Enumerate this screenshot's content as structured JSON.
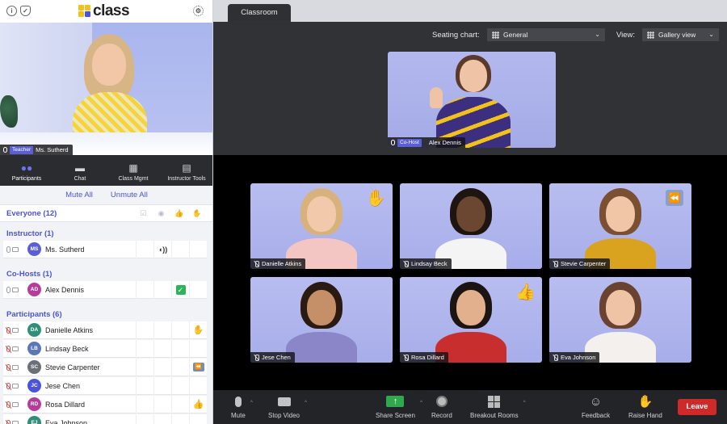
{
  "app": {
    "logo_text": "class",
    "info_icon": "info-icon",
    "shield_icon": "shield-icon",
    "settings_icon": "gear-icon"
  },
  "teacher_video": {
    "role": "Teacher",
    "name": "Ms. Sutherd"
  },
  "tabs": [
    {
      "label": "Participants",
      "icon": "people-icon",
      "active": true
    },
    {
      "label": "Chat",
      "icon": "chat-icon",
      "active": false
    },
    {
      "label": "Class Mgmt",
      "icon": "class-mgmt-icon",
      "active": false
    },
    {
      "label": "Instructor Tools",
      "icon": "clipboard-icon",
      "active": false
    }
  ],
  "actions": {
    "mute_all": "Mute All",
    "unmute_all": "Unmute All"
  },
  "everyone": {
    "label": "Everyone (12)"
  },
  "sections": {
    "instructor": "Instructor (1)",
    "cohosts": "Co-Hosts (1)",
    "participants": "Participants (6)"
  },
  "instructor_rows": [
    {
      "initials": "MS",
      "name": "Ms. Sutherd",
      "color": "#5a5fd6",
      "status": "speaking"
    }
  ],
  "cohost_rows": [
    {
      "initials": "AD",
      "name": "Alex Dennis",
      "color": "#b43d9c",
      "status": "check"
    }
  ],
  "participant_rows": [
    {
      "initials": "DA",
      "name": "Danielle Atkins",
      "color": "#2f8f7a",
      "status": "hand"
    },
    {
      "initials": "LB",
      "name": "Lindsay Beck",
      "color": "#5a78b8",
      "status": ""
    },
    {
      "initials": "SC",
      "name": "Stevie Carpenter",
      "color": "#6b6f78",
      "status": "rewind"
    },
    {
      "initials": "JC",
      "name": "Jese Chen",
      "color": "#4b53d8",
      "status": ""
    },
    {
      "initials": "RD",
      "name": "Rosa Dillard",
      "color": "#b43d9c",
      "status": "thumbs"
    },
    {
      "initials": "EJ",
      "name": "Eva Johnson",
      "color": "#2f8f7a",
      "status": ""
    }
  ],
  "classroom": {
    "tab_label": "Classroom",
    "seating_label": "Seating chart:",
    "seating_value": "General",
    "view_label": "View:",
    "view_value": "Gallery view"
  },
  "cohost_video": {
    "role": "Co-Host",
    "name": "Alex Dennis"
  },
  "gallery": [
    {
      "name": "Danielle Atkins",
      "badge": "hand",
      "hair": "#d7b27c",
      "skin": "#f2c9ab",
      "shirt": "#f3c6c4"
    },
    {
      "name": "Lindsay Beck",
      "badge": "",
      "hair": "#1e1410",
      "skin": "#6b4630",
      "shirt": "#f4f4f4"
    },
    {
      "name": "Stevie Carpenter",
      "badge": "rewind",
      "hair": "#7a4f32",
      "skin": "#f0c6a6",
      "shirt": "#d9a21f"
    },
    {
      "name": "Jese Chen",
      "badge": "",
      "hair": "#2b1a12",
      "skin": "#c58f68",
      "shirt": "#8a86c8"
    },
    {
      "name": "Rosa Dillard",
      "badge": "thumbs",
      "hair": "#1c1412",
      "skin": "#e3b08e",
      "shirt": "#c82e2e"
    },
    {
      "name": "Eva Johnson",
      "badge": "",
      "hair": "#6a4330",
      "skin": "#efc3a6",
      "shirt": "#f3f0ee"
    }
  ],
  "toolbar": {
    "mute": "Mute",
    "stop_video": "Stop Video",
    "share_screen": "Share Screen",
    "record": "Record",
    "breakout_rooms": "Breakout Rooms",
    "feedback": "Feedback",
    "raise_hand": "Raise Hand",
    "leave": "Leave"
  },
  "colors": {
    "accent": "#4b53d8",
    "leave": "#cf2a2a",
    "share": "#2fa94e",
    "check": "#2fb35a"
  }
}
